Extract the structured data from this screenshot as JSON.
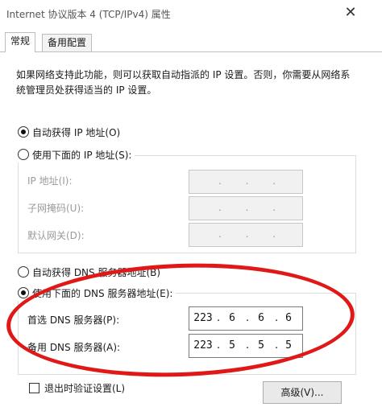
{
  "window": {
    "title": "Internet 协议版本 4 (TCP/IPv4) 属性",
    "close_glyph": "✕"
  },
  "tabs": [
    {
      "label": "常规",
      "active": true
    },
    {
      "label": "备用配置",
      "active": false
    }
  ],
  "description": "如果网络支持此功能，则可以获取自动指派的 IP 设置。否则，你需要从网络系统管理员处获得适当的 IP 设置。",
  "ip_mode": {
    "auto_label": "自动获得 IP 地址(O)",
    "manual_label": "使用下面的 IP 地址(S):",
    "selected": "auto",
    "fields": [
      {
        "label": "IP 地址(I):",
        "value": ". . ."
      },
      {
        "label": "子网掩码(U):",
        "value": ". . ."
      },
      {
        "label": "默认网关(D):",
        "value": ". . ."
      }
    ]
  },
  "dns_mode": {
    "auto_label": "自动获得 DNS 服务器地址(B)",
    "manual_label": "使用下面的 DNS 服务器地址(E):",
    "selected": "manual",
    "preferred": {
      "label": "首选 DNS 服务器(P):",
      "octets": [
        "223",
        "6",
        "6",
        "6"
      ]
    },
    "alternate": {
      "label": "备用 DNS 服务器(A):",
      "octets": [
        "223",
        "5",
        "5",
        "5"
      ]
    }
  },
  "validate_on_exit": {
    "label": "退出时验证设置(L)",
    "checked": false
  },
  "advanced_button": "高级(V)...",
  "annotation_color": "#e01818"
}
